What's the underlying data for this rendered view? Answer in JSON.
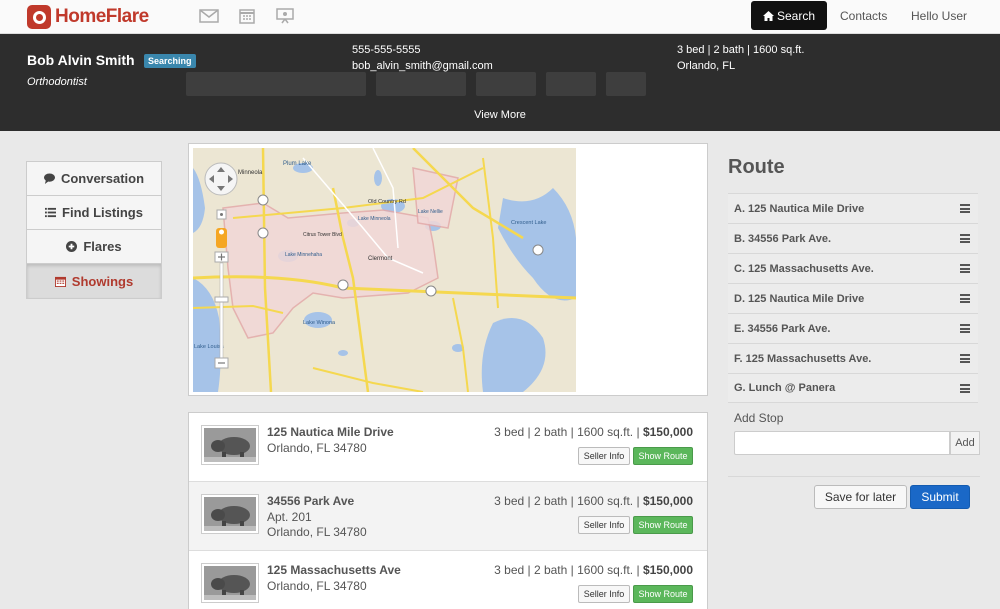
{
  "brand": {
    "name": "HomeFlare",
    "color": "#c0392b"
  },
  "nav": {
    "icons": [
      "mail-icon",
      "calendar-icon",
      "presentation-icon"
    ],
    "search_label": "Search",
    "contacts_label": "Contacts",
    "user_label": "Hello User"
  },
  "client": {
    "name": "Bob Alvin Smith",
    "status": "Searching",
    "occupation": "Orthodontist",
    "phone": "555-555-5555",
    "email": "bob_alvin_smith@gmail.com",
    "criteria": "3 bed | 2 bath | 1600 sq.ft.",
    "location": "Orlando, FL",
    "view_more": "View More"
  },
  "tabs": [
    {
      "label": "Conversation",
      "icon": "comment-icon"
    },
    {
      "label": "Find Listings",
      "icon": "list-icon"
    },
    {
      "label": "Flares",
      "icon": "plus-circle-icon"
    },
    {
      "label": "Showings",
      "icon": "calendar-icon",
      "active": true
    }
  ],
  "map": {
    "labels": [
      "Minneola",
      "Plum Lake",
      "Citrus Tower Blvd",
      "Old Country Rd",
      "Lake Minneola",
      "Clermont",
      "Lake Winona",
      "Crescent Lake",
      "Lake Nellie",
      "Lake Minnehaha",
      "Lake Louisa"
    ]
  },
  "listings": [
    {
      "street": "125 Nautica Mile Drive",
      "lines": [
        "Orlando, FL 34780"
      ],
      "specs": "3 bed | 2 bath | 1600 sq.ft. |",
      "price": "$150,000",
      "seller_label": "Seller Info",
      "route_label": "Show Route"
    },
    {
      "street": "34556 Park Ave",
      "lines": [
        "Apt. 201",
        "Orlando, FL 34780"
      ],
      "specs": "3 bed | 2 bath | 1600 sq.ft. |",
      "price": "$150,000",
      "seller_label": "Seller Info",
      "route_label": "Show Route"
    },
    {
      "street": "125 Massachusetts Ave",
      "lines": [
        "Orlando, FL 34780"
      ],
      "specs": "3 bed | 2 bath | 1600 sq.ft. |",
      "price": "$150,000",
      "seller_label": "Seller Info",
      "route_label": "Show Route"
    }
  ],
  "route": {
    "title": "Route",
    "stops": [
      "A. 125 Nautica Mile Drive",
      "B. 34556 Park Ave.",
      "C. 125 Massachusetts Ave.",
      "D. 125 Nautica Mile Drive",
      "E. 34556 Park Ave.",
      "F. 125 Massachusetts Ave.",
      "G. Lunch @ Panera"
    ],
    "add_stop_label": "Add Stop",
    "add_stop_value": "",
    "add_label": "Add",
    "save_label": "Save for later",
    "submit_label": "Submit"
  }
}
